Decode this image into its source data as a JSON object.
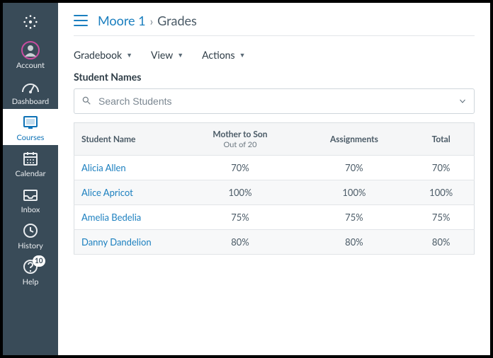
{
  "sidebar": {
    "items": [
      {
        "key": "account",
        "label": "Account"
      },
      {
        "key": "dashboard",
        "label": "Dashboard"
      },
      {
        "key": "courses",
        "label": "Courses",
        "active": true
      },
      {
        "key": "calendar",
        "label": "Calendar"
      },
      {
        "key": "inbox",
        "label": "Inbox"
      },
      {
        "key": "history",
        "label": "History"
      },
      {
        "key": "help",
        "label": "Help",
        "badge": "10"
      }
    ]
  },
  "breadcrumb": {
    "course": "Moore 1",
    "separator": "›",
    "current": "Grades"
  },
  "toolbar": {
    "gradebook": "Gradebook",
    "view": "View",
    "actions": "Actions"
  },
  "section_title": "Student Names",
  "search": {
    "placeholder": "Search Students"
  },
  "table": {
    "headers": {
      "student": "Student Name",
      "col1_title": "Mother to Son",
      "col1_sub": "Out of 20",
      "col2": "Assignments",
      "col3": "Total"
    },
    "rows": [
      {
        "name": "Alicia Allen",
        "c1": "70%",
        "c2": "70%",
        "c3": "70%"
      },
      {
        "name": "Alice Apricot",
        "c1": "100%",
        "c2": "100%",
        "c3": "100%"
      },
      {
        "name": "Amelia Bedelia",
        "c1": "75%",
        "c2": "75%",
        "c3": "75%"
      },
      {
        "name": "Danny Dandelion",
        "c1": "80%",
        "c2": "80%",
        "c3": "80%"
      }
    ]
  }
}
